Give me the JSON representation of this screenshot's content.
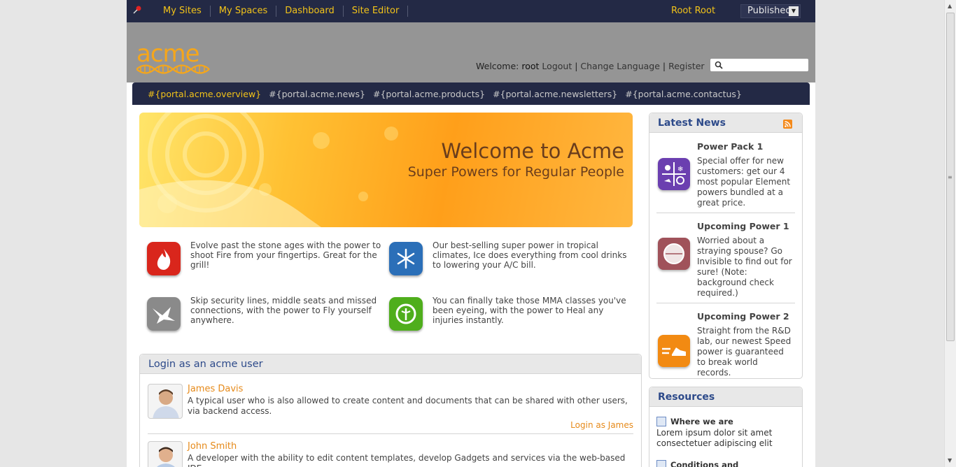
{
  "toolbar": {
    "nav": [
      "My Sites",
      "My Spaces",
      "Dashboard",
      "Site Editor"
    ],
    "user": "Root Root",
    "status": "Published"
  },
  "header": {
    "logo_text": "acme",
    "welcome_label": "Welcome:",
    "username": "root",
    "links": [
      "Logout",
      "Change Language",
      "Register"
    ],
    "search": {
      "placeholder": ""
    }
  },
  "portal_nav": [
    "#{portal.acme.overview}",
    "#{portal.acme.news}",
    "#{portal.acme.products}",
    "#{portal.acme.newsletters}",
    "#{portal.acme.contactus}"
  ],
  "banner": {
    "title": "Welcome to Acme",
    "subtitle": "Super Powers for Regular People"
  },
  "features": [
    {
      "icon": "fire-icon",
      "color": "#d9261c",
      "text": "Evolve past the stone ages with the power to shoot Fire from your fingertips. Great for the grill!"
    },
    {
      "icon": "snowflake-icon",
      "color": "#2b6fb8",
      "text": "Our best-selling super power in tropical climates, Ice does everything from cool drinks to lowering your A/C bill."
    },
    {
      "icon": "bird-icon",
      "color": "#8a8a8a",
      "text": "Skip security lines, middle seats and missed connections, with the power to Fly yourself anywhere."
    },
    {
      "icon": "heal-icon",
      "color": "#4fae1c",
      "text": "You can finally take those MMA classes you've been eyeing, with the power to Heal any injuries instantly."
    }
  ],
  "login": {
    "title": "Login as an acme user",
    "users": [
      {
        "name": "James Davis",
        "description": "A typical user who is also allowed to create content and documents that can be shared with other users, via backend access.",
        "link": "Login as James"
      },
      {
        "name": "John Smith",
        "description": "A developer with the ability to edit content templates, develop Gadgets and services via the web-based IDE.",
        "link": ""
      }
    ]
  },
  "latest_news": {
    "title": "Latest News",
    "items": [
      {
        "title": "Power Pack 1",
        "icon": "power-pack-icon",
        "color": "#6b3fb0",
        "description": "Special offer for new customers: get our 4 most popular Element powers bundled at a great price."
      },
      {
        "title": "Upcoming Power 1",
        "icon": "invisible-icon",
        "color": "#a0525a",
        "description": "Worried about a straying spouse? Go Invisible to find out for sure! (Note: background check required.)"
      },
      {
        "title": "Upcoming Power 2",
        "icon": "speed-icon",
        "color": "#f28a12",
        "description": "Straight from the R&D lab, our newest Speed power is guaranteed to break world records."
      }
    ]
  },
  "resources": {
    "title": "Resources",
    "items": [
      {
        "title": "Where we are",
        "description": "Lorem ipsum dolor sit amet consectetuer adipiscing elit"
      },
      {
        "title": "Conditions and",
        "description": ""
      }
    ]
  }
}
